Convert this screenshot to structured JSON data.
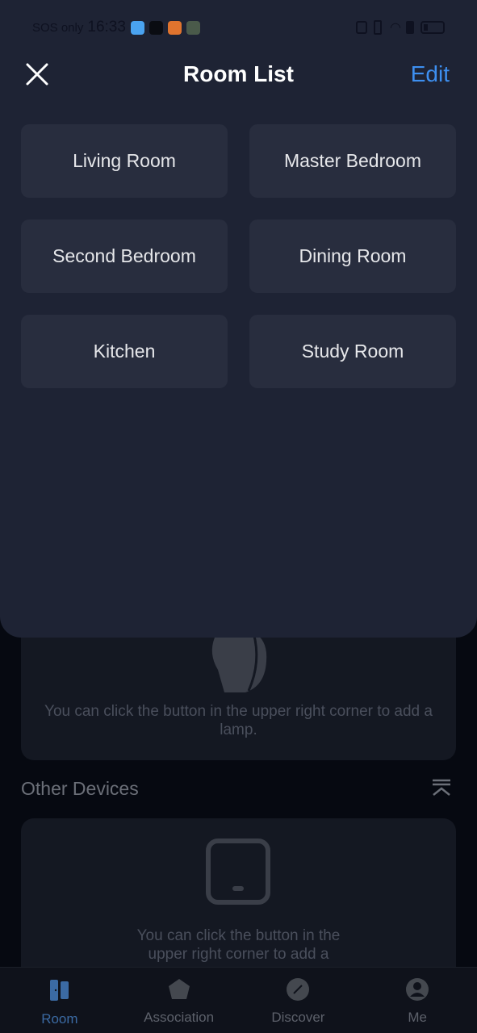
{
  "status": {
    "carrier": "SOS only",
    "time": "16:33"
  },
  "header": {
    "title": "Room List",
    "edit_label": "Edit"
  },
  "rooms": [
    {
      "label": "Living Room"
    },
    {
      "label": "Master Bedroom"
    },
    {
      "label": "Second Bedroom"
    },
    {
      "label": "Dining Room"
    },
    {
      "label": "Kitchen"
    },
    {
      "label": "Study Room"
    }
  ],
  "background": {
    "lamp_hint": "You can click the button in the upper right corner to add a lamp.",
    "other_devices_title": "Other Devices",
    "other_hint": "You can click the button in the upper right corner to add a"
  },
  "nav": {
    "tabs": [
      {
        "label": "Room",
        "icon": "door-icon",
        "active": true
      },
      {
        "label": "Association",
        "icon": "pentagon-icon"
      },
      {
        "label": "Discover",
        "icon": "compass-icon"
      },
      {
        "label": "Me",
        "icon": "user-icon"
      }
    ]
  },
  "colors": {
    "accent": "#3d8ff0",
    "sheet": "#1e2334",
    "room_button": "#282d3e"
  }
}
